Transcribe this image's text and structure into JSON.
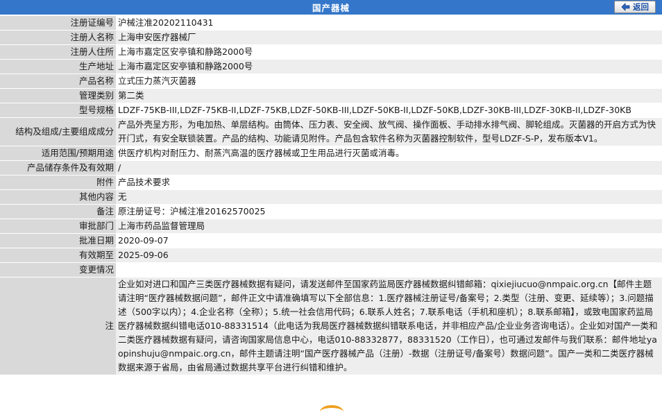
{
  "header": {
    "title": "国产器械",
    "back_label": "返回"
  },
  "colors": {
    "header_bg": "#3476c9",
    "label_bg": "#d9d9d9",
    "row_alt_bg": "#eeeeee"
  },
  "rows": [
    {
      "label": "注册证编号",
      "value": "沪械注准20202110431"
    },
    {
      "label": "注册人名称",
      "value": "上海申安医疗器械厂"
    },
    {
      "label": "注册人住所",
      "value": "上海市嘉定区安亭镇和静路2000号"
    },
    {
      "label": "生产地址",
      "value": "上海市嘉定区安亭镇和静路2000号"
    },
    {
      "label": "产品名称",
      "value": "立式压力蒸汽灭菌器"
    },
    {
      "label": "管理类别",
      "value": "第二类"
    },
    {
      "label": "型号规格",
      "value": "LDZF-75KB-III,LDZF-75KB-II,LDZF-75KB,LDZF-50KB-III,LDZF-50KB-II,LDZF-50KB,LDZF-30KB-III,LDZF-30KB-II,LDZF-30KB"
    },
    {
      "label": "结构及组成/主要组成成分",
      "value": "产品外壳呈方形，为电加热、单层结构。由筒体、压力表、安全阀、放气阀、操作面板、手动排水排气阀、脚轮组成。灭菌器的开启方式为快开门式，有安全联锁装置。产品的结构、功能请见附件。产品包含软件名称为灭菌器控制软件，型号LDZF-S-P，发布版本V1。"
    },
    {
      "label": "适用范围/预期用途",
      "value": "供医疗机构对耐压力、耐蒸汽高温的医疗器械或卫生用品进行灭菌或消毒。"
    },
    {
      "label": "产品储存条件及有效期",
      "value": "/"
    },
    {
      "label": "附件",
      "value": "产品技术要求"
    },
    {
      "label": "其他内容",
      "value": "无"
    },
    {
      "label": "备注",
      "value": "原注册证号：沪械注准20162570025"
    },
    {
      "label": "审批部门",
      "value": "上海市药品监督管理局"
    },
    {
      "label": "批准日期",
      "value": "2020-09-07"
    },
    {
      "label": "有效期至",
      "value": "2025-09-06"
    },
    {
      "label": "变更情况",
      "value": ""
    }
  ],
  "note": {
    "label": "注",
    "text": "企业如对进口和国产三类医疗器械数据有疑问，请发送邮件至国家药监局医疗器械数据纠错邮箱：qixiejiucuo@nmpaic.org.cn【邮件主题请注明“医疗器械数据问题”，邮件正文中请准确填写以下全部信息：1.医疗器械注册证号/备案号；2.类型（注册、变更、延续等）；3.问题描述（500字以内）；4.企业名称（全称）；5.统一社会信用代码；6.联系人姓名；7.联系电话（手机和座机）；8.联系邮箱】，或致电国家药监局医疗器械数据纠错电话010-88331514（此电话为我局医疗器械数据纠错联系电话，并非相应产品/企业业务咨询电话）。企业如对国产一类和二类医疗器械数据有疑问，请咨询国家局信息中心，电话010-88332877，88331520（工作日），也可通过发邮件与我们联系：邮件地址yaopinshuju@nmpaic.org.cn，邮件主题请注明“国产医疗器械产品（注册）-数据（注册证号/备案号）数据问题”。国产一类和二类医疗器械数据来源于省局，由省局通过数据共享平台进行纠错和维护。"
  }
}
